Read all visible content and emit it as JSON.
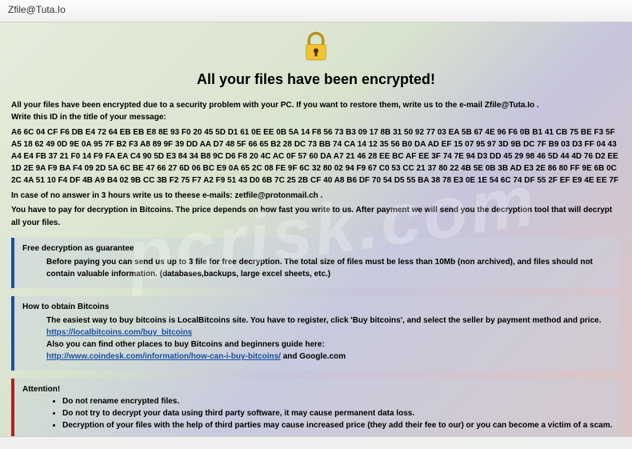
{
  "titlebar": {
    "title": "Zfile@Tuta.Io"
  },
  "heading": "All your files have been encrypted!",
  "intro": {
    "pre": "All your files have been encrypted due to a security problem with your PC. If you want to restore them, write us to the e-mail ",
    "email": "Zfile@Tuta.Io",
    "post": " .",
    "id_line": "Write this ID in the title of your message:"
  },
  "hexid": "A6 6C 04 CF F6 DB E4 72 64 EB EB E8 8E 93 F0 20 45 5D D1 61 0E EE 0B 5A 14 F8 56 73 B3 09 17 8B 31 50 92 77 03 EA 5B 67 4E 96 F6 0B B1 41 CB 75 BE F3 5F A5 18 62 49 0D 9E 0A 95 7F B2 F3 A8 89 9F 39 DD AA D7 48 5F 66 65 B2 28 DC 73 BB 74 CA 14 12 35 56 B0 DA AD EF 15 07 95 97 3D 9B DC 7F B9 03 D3 FF 04 43 A4 E4 FB 37 21 F0 14 F9 FA EA C4 90 5D E3 84 34 B8 9C D6 F8 20 4C AC 0F 57 60 DA A7 21 46 28 EE BC AF EE 3F 74 7E 94 D3 DD 45 29 98 46 5D 44 4D 76 D2 EE 1D 2E 9A F9 BA F4 09 2D 5A 6C BE 47 66 27 6D 06 BC E9 0A 65 2C 08 FE 9F 6C 32 80 02 94 F9 67 C0 53 CC 21 37 80 22 4B 5E 0B 3B AD E3 2E 86 80 FF 9E 6B 0C 2C 4A 51 10 F4 DF 4B A9 B4 02 9B CC 3B F2 75 F7 A2 F9 51 43 D0 6B 7C 25 2B CF 40 A8 B6 DF 70 54 D5 55 BA 38 78 E3 0E 1E 54 6C 74 DF 55 2F EF E9 4E EE 7F",
  "noanswer": {
    "pre": "In case of no answer in 3 hours write us to theese e-mails: ",
    "email": "zetfile@protonmail.ch",
    "post": " ."
  },
  "payline": "You have to pay for decryption in Bitcoins. The price depends on how fast you write to us. After payment we will send you the decryption tool that will decrypt all your files.",
  "panel_free": {
    "title": "Free decryption as guarantee",
    "body": "Before paying you can send us up to 3 file for free decryption. The total size of files must be less than 10Mb (non archived), and files should not contain valuable information. (databases,backups, large excel sheets, etc.)"
  },
  "panel_btc": {
    "title": "How to obtain Bitcoins",
    "l1": "The easiest way to buy bitcoins is LocalBitcoins site. You have to register, click 'Buy bitcoins', and select the seller by payment method and price.",
    "link1": "https://localbitcoins.com/buy_bitcoins",
    "l2": "Also you can find other places to buy Bitcoins and beginners guide here:",
    "link2": "http://www.coindesk.com/information/how-can-i-buy-bitcoins/",
    "l2_post": " and Google.com"
  },
  "panel_attn": {
    "title": "Attention!",
    "items": [
      "Do not rename encrypted files.",
      "Do not try to decrypt your data using third party software, it may cause permanent data loss.",
      "Decryption of your files with the help of third parties may cause increased price (they add their fee to our) or you can become a victim of a scam."
    ]
  }
}
